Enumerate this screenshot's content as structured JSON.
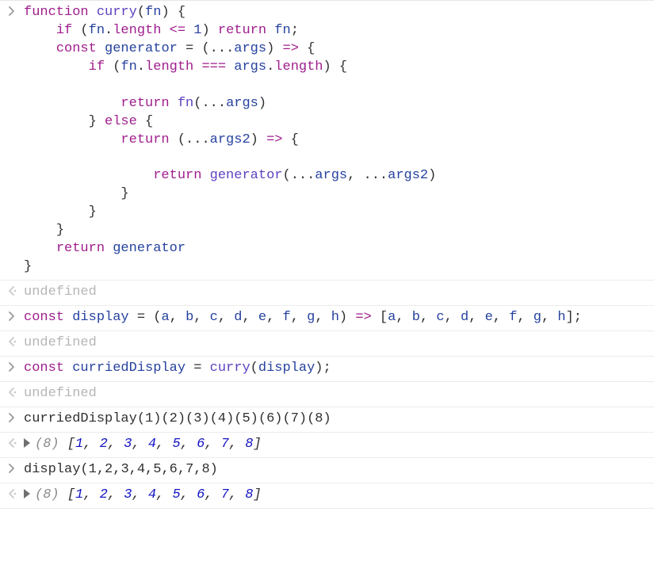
{
  "rows": [
    {
      "type": "input",
      "tokens": [
        {
          "t": "function ",
          "c": "kw"
        },
        {
          "t": "curry",
          "c": "fn"
        },
        {
          "t": "(",
          "c": "punc"
        },
        {
          "t": "fn",
          "c": "id"
        },
        {
          "t": ") {",
          "c": "punc"
        },
        {
          "t": "\n",
          "c": "punc"
        },
        {
          "t": "    ",
          "c": "punc"
        },
        {
          "t": "if ",
          "c": "kw"
        },
        {
          "t": "(",
          "c": "punc"
        },
        {
          "t": "fn",
          "c": "id"
        },
        {
          "t": ".",
          "c": "punc"
        },
        {
          "t": "length",
          "c": "prop"
        },
        {
          "t": " <= ",
          "c": "op"
        },
        {
          "t": "1",
          "c": "num"
        },
        {
          "t": ") ",
          "c": "punc"
        },
        {
          "t": "return ",
          "c": "kw"
        },
        {
          "t": "fn",
          "c": "id"
        },
        {
          "t": ";",
          "c": "punc"
        },
        {
          "t": "\n",
          "c": "punc"
        },
        {
          "t": "    ",
          "c": "punc"
        },
        {
          "t": "const ",
          "c": "kw"
        },
        {
          "t": "generator",
          "c": "id"
        },
        {
          "t": " = (",
          "c": "punc"
        },
        {
          "t": "...",
          "c": "punc"
        },
        {
          "t": "args",
          "c": "id"
        },
        {
          "t": ") ",
          "c": "punc"
        },
        {
          "t": "=>",
          "c": "op"
        },
        {
          "t": " {",
          "c": "punc"
        },
        {
          "t": "\n",
          "c": "punc"
        },
        {
          "t": "        ",
          "c": "punc"
        },
        {
          "t": "if ",
          "c": "kw"
        },
        {
          "t": "(",
          "c": "punc"
        },
        {
          "t": "fn",
          "c": "id"
        },
        {
          "t": ".",
          "c": "punc"
        },
        {
          "t": "length",
          "c": "prop"
        },
        {
          "t": " === ",
          "c": "op"
        },
        {
          "t": "args",
          "c": "id"
        },
        {
          "t": ".",
          "c": "punc"
        },
        {
          "t": "length",
          "c": "prop"
        },
        {
          "t": ") {",
          "c": "punc"
        },
        {
          "t": "\n",
          "c": "punc"
        },
        {
          "t": "\n",
          "c": "punc"
        },
        {
          "t": "            ",
          "c": "punc"
        },
        {
          "t": "return ",
          "c": "kw"
        },
        {
          "t": "fn",
          "c": "fn"
        },
        {
          "t": "(",
          "c": "punc"
        },
        {
          "t": "...",
          "c": "punc"
        },
        {
          "t": "args",
          "c": "id"
        },
        {
          "t": ")",
          "c": "punc"
        },
        {
          "t": "\n",
          "c": "punc"
        },
        {
          "t": "        } ",
          "c": "punc"
        },
        {
          "t": "else",
          "c": "kw"
        },
        {
          "t": " {",
          "c": "punc"
        },
        {
          "t": "\n",
          "c": "punc"
        },
        {
          "t": "            ",
          "c": "punc"
        },
        {
          "t": "return ",
          "c": "kw"
        },
        {
          "t": "(",
          "c": "punc"
        },
        {
          "t": "...",
          "c": "punc"
        },
        {
          "t": "args2",
          "c": "id"
        },
        {
          "t": ") ",
          "c": "punc"
        },
        {
          "t": "=>",
          "c": "op"
        },
        {
          "t": " {",
          "c": "punc"
        },
        {
          "t": "\n",
          "c": "punc"
        },
        {
          "t": "\n",
          "c": "punc"
        },
        {
          "t": "                ",
          "c": "punc"
        },
        {
          "t": "return ",
          "c": "kw"
        },
        {
          "t": "generator",
          "c": "fn"
        },
        {
          "t": "(",
          "c": "punc"
        },
        {
          "t": "...",
          "c": "punc"
        },
        {
          "t": "args",
          "c": "id"
        },
        {
          "t": ", ",
          "c": "punc"
        },
        {
          "t": "...",
          "c": "punc"
        },
        {
          "t": "args2",
          "c": "id"
        },
        {
          "t": ")",
          "c": "punc"
        },
        {
          "t": "\n",
          "c": "punc"
        },
        {
          "t": "            }",
          "c": "punc"
        },
        {
          "t": "\n",
          "c": "punc"
        },
        {
          "t": "        }",
          "c": "punc"
        },
        {
          "t": "\n",
          "c": "punc"
        },
        {
          "t": "    }",
          "c": "punc"
        },
        {
          "t": "\n",
          "c": "punc"
        },
        {
          "t": "    ",
          "c": "punc"
        },
        {
          "t": "return ",
          "c": "kw"
        },
        {
          "t": "generator",
          "c": "id"
        },
        {
          "t": "\n",
          "c": "punc"
        },
        {
          "t": "}",
          "c": "punc"
        }
      ]
    },
    {
      "type": "output-undef",
      "text": "undefined"
    },
    {
      "type": "input",
      "tokens": [
        {
          "t": "const ",
          "c": "kw"
        },
        {
          "t": "display",
          "c": "id"
        },
        {
          "t": " = (",
          "c": "punc"
        },
        {
          "t": "a",
          "c": "id"
        },
        {
          "t": ", ",
          "c": "punc"
        },
        {
          "t": "b",
          "c": "id"
        },
        {
          "t": ", ",
          "c": "punc"
        },
        {
          "t": "c",
          "c": "id"
        },
        {
          "t": ", ",
          "c": "punc"
        },
        {
          "t": "d",
          "c": "id"
        },
        {
          "t": ", ",
          "c": "punc"
        },
        {
          "t": "e",
          "c": "id"
        },
        {
          "t": ", ",
          "c": "punc"
        },
        {
          "t": "f",
          "c": "id"
        },
        {
          "t": ", ",
          "c": "punc"
        },
        {
          "t": "g",
          "c": "id"
        },
        {
          "t": ", ",
          "c": "punc"
        },
        {
          "t": "h",
          "c": "id"
        },
        {
          "t": ") ",
          "c": "punc"
        },
        {
          "t": "=>",
          "c": "op"
        },
        {
          "t": " [",
          "c": "punc"
        },
        {
          "t": "a",
          "c": "id"
        },
        {
          "t": ", ",
          "c": "punc"
        },
        {
          "t": "b",
          "c": "id"
        },
        {
          "t": ", ",
          "c": "punc"
        },
        {
          "t": "c",
          "c": "id"
        },
        {
          "t": ", ",
          "c": "punc"
        },
        {
          "t": "d",
          "c": "id"
        },
        {
          "t": ", ",
          "c": "punc"
        },
        {
          "t": "e",
          "c": "id"
        },
        {
          "t": ", ",
          "c": "punc"
        },
        {
          "t": "f",
          "c": "id"
        },
        {
          "t": ", ",
          "c": "punc"
        },
        {
          "t": "g",
          "c": "id"
        },
        {
          "t": ", ",
          "c": "punc"
        },
        {
          "t": "h",
          "c": "id"
        },
        {
          "t": "];",
          "c": "punc"
        }
      ]
    },
    {
      "type": "output-undef",
      "text": "undefined"
    },
    {
      "type": "input",
      "tokens": [
        {
          "t": "const ",
          "c": "kw"
        },
        {
          "t": "curriedDisplay",
          "c": "id"
        },
        {
          "t": " = ",
          "c": "punc"
        },
        {
          "t": "curry",
          "c": "fn"
        },
        {
          "t": "(",
          "c": "punc"
        },
        {
          "t": "display",
          "c": "id"
        },
        {
          "t": ");",
          "c": "punc"
        }
      ]
    },
    {
      "type": "output-undef",
      "text": "undefined"
    },
    {
      "type": "input",
      "tokens": [
        {
          "t": "curriedDisplay",
          "c": "plain"
        },
        {
          "t": "(",
          "c": "plain"
        },
        {
          "t": "1",
          "c": "plain"
        },
        {
          "t": ")(",
          "c": "plain"
        },
        {
          "t": "2",
          "c": "plain"
        },
        {
          "t": ")(",
          "c": "plain"
        },
        {
          "t": "3",
          "c": "plain"
        },
        {
          "t": ")(",
          "c": "plain"
        },
        {
          "t": "4",
          "c": "plain"
        },
        {
          "t": ")(",
          "c": "plain"
        },
        {
          "t": "5",
          "c": "plain"
        },
        {
          "t": ")(",
          "c": "plain"
        },
        {
          "t": "6",
          "c": "plain"
        },
        {
          "t": ")(",
          "c": "plain"
        },
        {
          "t": "7",
          "c": "plain"
        },
        {
          "t": ")(",
          "c": "plain"
        },
        {
          "t": "8",
          "c": "plain"
        },
        {
          "t": ")",
          "c": "plain"
        }
      ]
    },
    {
      "type": "output-array",
      "length": 8,
      "values": [
        1,
        2,
        3,
        4,
        5,
        6,
        7,
        8
      ]
    },
    {
      "type": "input",
      "tokens": [
        {
          "t": "display",
          "c": "plain"
        },
        {
          "t": "(",
          "c": "plain"
        },
        {
          "t": "1",
          "c": "plain"
        },
        {
          "t": ",",
          "c": "plain"
        },
        {
          "t": "2",
          "c": "plain"
        },
        {
          "t": ",",
          "c": "plain"
        },
        {
          "t": "3",
          "c": "plain"
        },
        {
          "t": ",",
          "c": "plain"
        },
        {
          "t": "4",
          "c": "plain"
        },
        {
          "t": ",",
          "c": "plain"
        },
        {
          "t": "5",
          "c": "plain"
        },
        {
          "t": ",",
          "c": "plain"
        },
        {
          "t": "6",
          "c": "plain"
        },
        {
          "t": ",",
          "c": "plain"
        },
        {
          "t": "7",
          "c": "plain"
        },
        {
          "t": ",",
          "c": "plain"
        },
        {
          "t": "8",
          "c": "plain"
        },
        {
          "t": ")",
          "c": "plain"
        }
      ]
    },
    {
      "type": "output-array",
      "length": 8,
      "values": [
        1,
        2,
        3,
        4,
        5,
        6,
        7,
        8
      ]
    }
  ]
}
